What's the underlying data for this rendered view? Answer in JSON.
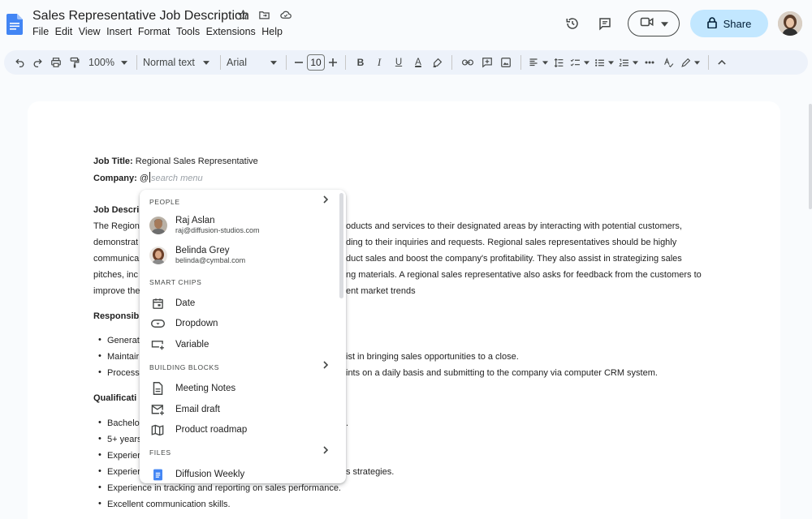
{
  "app": {
    "doc_title": "Sales Representative Job Description",
    "menu": [
      "File",
      "Edit",
      "View",
      "Insert",
      "Format",
      "Tools",
      "Extensions",
      "Help"
    ],
    "share_label": "Share"
  },
  "toolbar": {
    "zoom": "100%",
    "style": "Normal text",
    "font": "Arial",
    "font_size": "10",
    "bold": "B",
    "italic": "I",
    "underline": "U",
    "text_color": "A"
  },
  "document": {
    "job_title_label": "Job Title:",
    "job_title_value": " Regional Sales Representative",
    "company_label": "Company:",
    "company_value": " @",
    "company_placeholder": "search menu",
    "job_desc_heading": "Job Descri",
    "desc_lines": [
      {
        "left": "The Region",
        "right": "oducts and services to their designated areas by interacting with potential customers,"
      },
      {
        "left": "demonstrat",
        "right": "ding to their inquiries and requests. Regional sales representatives should be highly"
      },
      {
        "left": "communica",
        "right": "duct sales and boost the company's profitability. They also assist in strategizing sales"
      },
      {
        "left": "pitches, inc",
        "right": "ng materials. A regional sales representative also asks for feedback from the customers to"
      },
      {
        "left": "improve the",
        "right": "ent market trends"
      }
    ],
    "responsibilities_heading": "Responsib",
    "responsibilities": [
      {
        "left": "Generat",
        "right": ""
      },
      {
        "left": "Maintair",
        "right": "ist in bringing sales opportunities to a close."
      },
      {
        "left": "Process",
        "right": "ints on a daily basis and submitting to the company via computer CRM system."
      }
    ],
    "qualifications_heading": "Qualificati",
    "qualifications": [
      {
        "left": "Bachelo",
        "right": "."
      },
      {
        "left": "5+ years",
        "right": ""
      },
      {
        "left": "Experier",
        "right": ""
      },
      {
        "left": "Experier",
        "right": "s strategies."
      },
      {
        "left": "Experience in tracking and reporting on sales performance.",
        "right": ""
      },
      {
        "left": "Excellent communication skills.",
        "right": ""
      }
    ]
  },
  "popup": {
    "people_header": "PEOPLE",
    "people": [
      {
        "name": "Raj Aslan",
        "email": "raj@diffusion-studios.com"
      },
      {
        "name": "Belinda Grey",
        "email": "belinda@cymbal.com"
      }
    ],
    "smart_chips_header": "SMART CHIPS",
    "smart_chips": [
      "Date",
      "Dropdown",
      "Variable"
    ],
    "building_blocks_header": "BUILDING BLOCKS",
    "building_blocks": [
      "Meeting Notes",
      "Email draft",
      "Product roadmap"
    ],
    "files_header": "FILES",
    "files": [
      "Diffusion Weekly"
    ]
  },
  "colors": {
    "accent": "#0b57d0",
    "share_bg": "#c2e7ff",
    "toolbar_bg": "#edf2fa",
    "docs_blue": "#4285f4"
  },
  "icons": {
    "title": [
      "star-icon",
      "move-to-folder-icon",
      "cloud-saved-icon"
    ],
    "header_right": [
      "version-history-icon",
      "comments-icon",
      "meet-icon",
      "lock-icon"
    ],
    "smart_chips": [
      "calendar-icon",
      "dropdown-chip-icon",
      "variable-icon"
    ],
    "building_blocks": [
      "meeting-notes-icon",
      "email-draft-icon",
      "roadmap-icon"
    ],
    "files": [
      "docs-file-icon"
    ]
  }
}
